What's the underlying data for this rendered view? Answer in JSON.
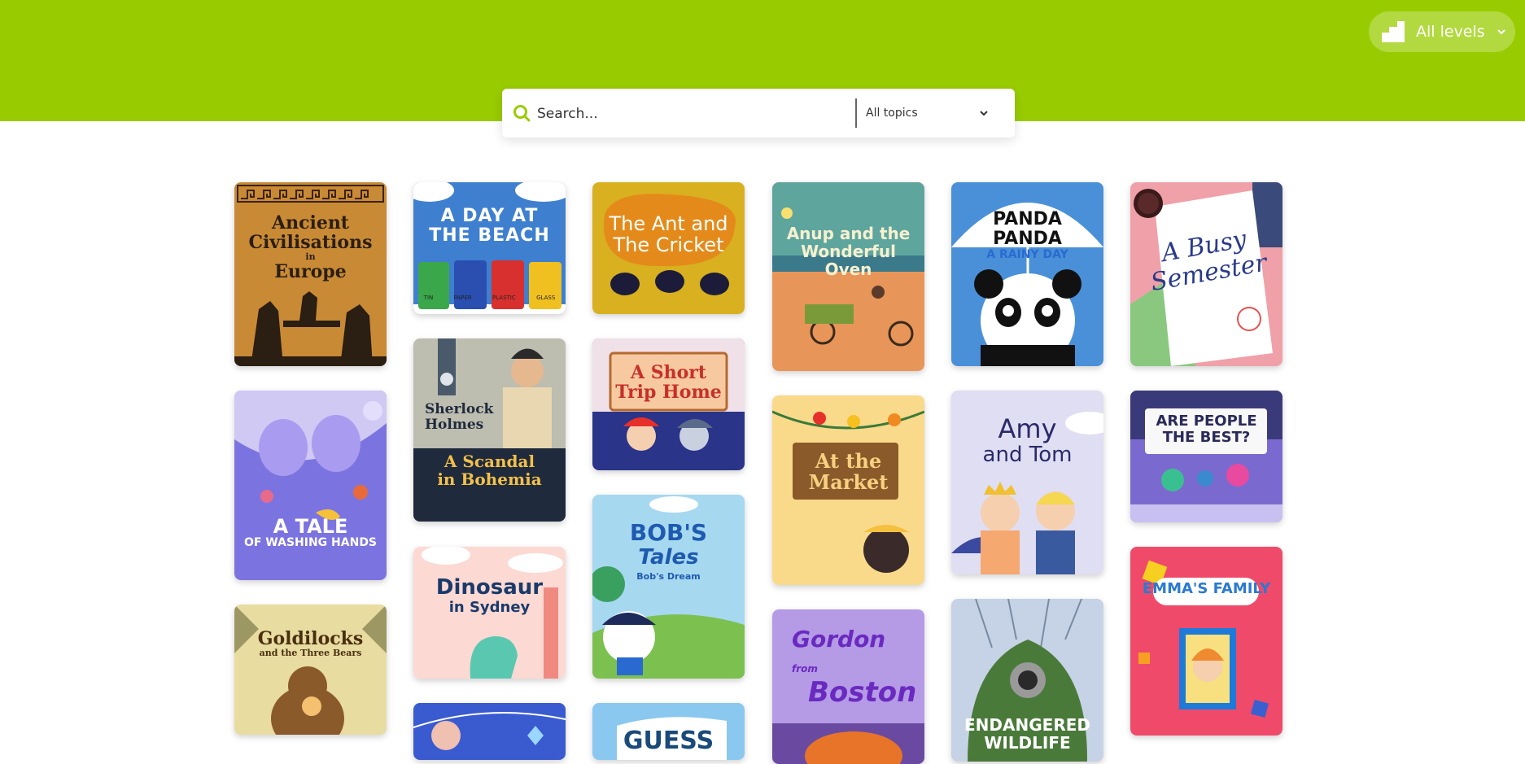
{
  "header": {
    "level_button": {
      "label": "All levels",
      "icon": "levels-bars-icon"
    },
    "background_color": "#99cc00"
  },
  "search": {
    "placeholder": "Search...",
    "value": "",
    "topic_select": {
      "selected": "All topics"
    }
  },
  "books": [
    {
      "id": "ancient",
      "title_lines": [
        "Ancient",
        "Civilisations",
        "in",
        "Europe"
      ]
    },
    {
      "id": "beach",
      "title_lines": [
        "A DAY AT",
        "THE BEACH"
      ],
      "bin_labels": [
        "TIN",
        "PAPER",
        "PLASTIC",
        "GLASS"
      ]
    },
    {
      "id": "ant",
      "title_lines": [
        "The Ant and",
        "The Cricket"
      ]
    },
    {
      "id": "anup",
      "title_lines": [
        "Anup and the",
        "Wonderful",
        "Oven"
      ]
    },
    {
      "id": "panda",
      "title_lines": [
        "PANDA PANDA",
        "A RAINY DAY"
      ]
    },
    {
      "id": "busy",
      "title_lines": [
        "A Busy",
        "Semester"
      ]
    },
    {
      "id": "washing",
      "title_lines": [
        "A TALE",
        "OF WASHING HANDS"
      ]
    },
    {
      "id": "sherlock",
      "title_lines": [
        "Sherlock",
        "Holmes",
        "A Scandal",
        "in Bohemia"
      ]
    },
    {
      "id": "trip",
      "title_lines": [
        "A Short",
        "Trip Home"
      ]
    },
    {
      "id": "market",
      "title_lines": [
        "At the",
        "Market"
      ]
    },
    {
      "id": "amy",
      "title_lines": [
        "Amy",
        "and Tom"
      ]
    },
    {
      "id": "people",
      "title_lines": [
        "ARE PEOPLE",
        "THE BEST?"
      ]
    },
    {
      "id": "goldilocks",
      "title_lines": [
        "Goldilocks",
        "and the Three Bears"
      ]
    },
    {
      "id": "dinosaur",
      "title_lines": [
        "Dinosaur",
        "in Sydney"
      ]
    },
    {
      "id": "bob",
      "title_lines": [
        "BOB'S",
        "Tales",
        "Bob's Dream"
      ]
    },
    {
      "id": "gordon",
      "title_lines": [
        "Gordon",
        "from",
        "Boston"
      ]
    },
    {
      "id": "wildlife",
      "title_lines": [
        "ENDANGERED",
        "WILDLIFE"
      ]
    },
    {
      "id": "emma",
      "title_lines": [
        "EMMA'S FAMILY"
      ]
    },
    {
      "id": "guess",
      "title_lines": [
        "GUESS"
      ]
    }
  ]
}
